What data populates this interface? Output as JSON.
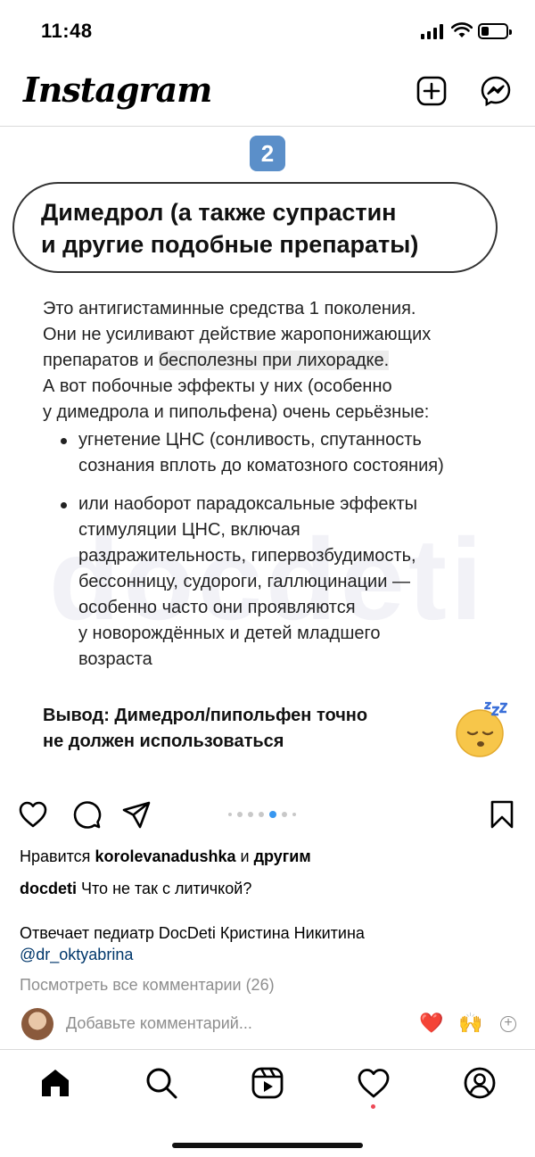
{
  "status_bar": {
    "time": "11:48"
  },
  "header": {
    "logo": "Instagram",
    "icons": [
      "new-post-icon",
      "messenger-icon"
    ]
  },
  "post_image": {
    "slide_number": "2",
    "watermark": "docdeti",
    "title_line1": "Димедрол  (а также супрастин",
    "title_line2": "и другие подобные препараты)",
    "para_lines": [
      "Это антигистаминные средства 1 поколения.",
      "Они не усиливают действие жаропонижающих",
      "препаратов и "
    ],
    "para_highlight": "бесполезны при лихорадке.",
    "para2_lines": [
      "А вот побочные эффекты у них (особенно",
      "у димедрола и пипольфена) очень серьёзные:"
    ],
    "bullet1_lines": [
      "угнетение ЦНС (сонливость, спутанность",
      "сознания вплоть до коматозного состояния)"
    ],
    "bullet2_lines": [
      "или наоборот парадоксальные эффекты",
      "стимуляции ЦНС, включая",
      "раздражительность, гипервозбудимость,",
      "бессонницу, судороги, галлюцинации —",
      "особенно часто они проявляются",
      "у новорождённых и детей младшего",
      "возраста"
    ],
    "conclusion_lines": [
      "Вывод: Димедрол/пипольфен точно",
      "не должен использоваться"
    ],
    "emoji": "sleeping-face"
  },
  "actions": {
    "carousel_total": 7,
    "carousel_active": 4
  },
  "likes": {
    "prefix": "Нравится ",
    "user": "korolevanadushka",
    "middle": " и ",
    "suffix": "другим"
  },
  "caption": {
    "user": "docdeti",
    "text": " Что не так с литичкой?"
  },
  "reply_text": "Отвечает педиатр DocDeti Кристина Никитина",
  "mention": "@dr_oktyabrina",
  "view_all": "Посмотреть все комментарии (26)",
  "comment_input": {
    "placeholder": "Добавьте комментарий...",
    "quick_reactions": [
      "❤️",
      "🙌"
    ]
  },
  "bottom_nav": [
    "home",
    "search",
    "reels",
    "activity",
    "profile"
  ],
  "colors": {
    "link": "#00376b",
    "muted": "#8e8e8e",
    "badge": "#5b8fc9",
    "active_dot": "#3897f0",
    "notification": "#ed4956"
  }
}
